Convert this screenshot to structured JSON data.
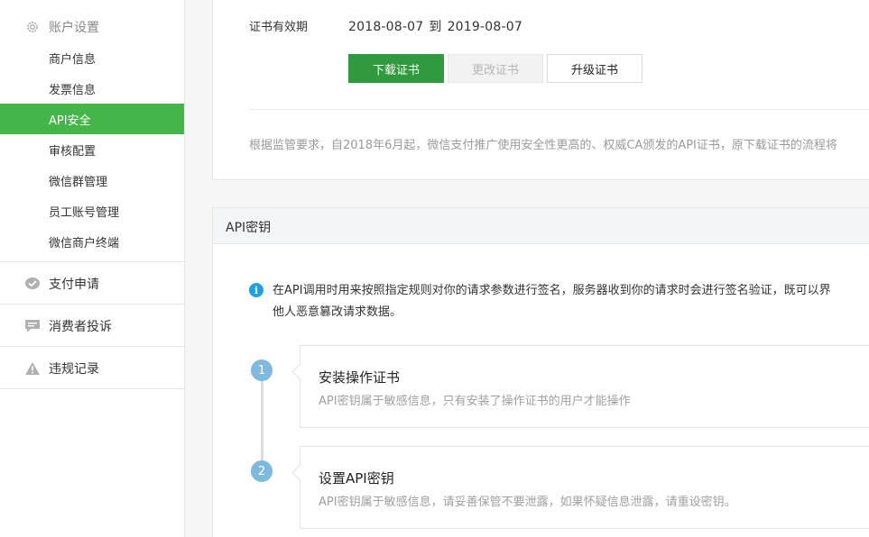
{
  "sidebar": {
    "account_group": {
      "label": "账户设置",
      "icon": "gear-icon"
    },
    "account_items": [
      {
        "label": "商户信息"
      },
      {
        "label": "发票信息"
      },
      {
        "label": "API安全",
        "active": true
      },
      {
        "label": "审核配置"
      },
      {
        "label": "微信群管理"
      },
      {
        "label": "员工账号管理"
      },
      {
        "label": "微信商户终端"
      }
    ],
    "groups": [
      {
        "label": "支付申请",
        "icon": "check-bubble-icon"
      },
      {
        "label": "消费者投诉",
        "icon": "chat-icon"
      },
      {
        "label": "违规记录",
        "icon": "warning-icon"
      }
    ],
    "active_color": "#44b549"
  },
  "certificate": {
    "validity_label": "证书有效期",
    "start_date": "2018-08-07",
    "to_word": "到",
    "end_date": "2019-08-07",
    "buttons": {
      "download": "下载证书",
      "change": "更改证书",
      "upgrade": "升级证书"
    },
    "notice": "根据监管要求，自2018年6月起，微信支付推广使用安全性更高的、权威CA颁发的API证书，原下载证书的流程将"
  },
  "api_key": {
    "section_title": "API密钥",
    "info_line1": "在API调用时用来按照指定规则对你的请求参数进行签名，服务器收到你的请求时会进行签名验证，既可以界",
    "info_line2": "他人恶意篡改请求数据。",
    "steps": [
      {
        "number": "1",
        "title": "安装操作证书",
        "desc": "API密钥属于敏感信息，只有安装了操作证书的用户才能操作"
      },
      {
        "number": "2",
        "title": "设置API密钥",
        "desc": "API密钥属于敏感信息，请妥善保管不要泄露，如果怀疑信息泄露，请重设密钥。"
      }
    ]
  },
  "colors": {
    "primary_button": "#2f9a3e",
    "info_icon": "#1aa2e6",
    "step_badge": "#7fb9e0"
  }
}
